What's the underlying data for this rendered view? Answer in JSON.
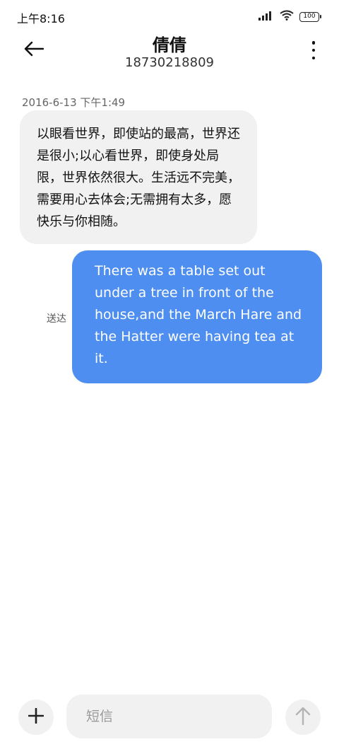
{
  "status_bar": {
    "time": "上午8:16",
    "battery": "100",
    "icons": [
      "signal-icon",
      "wifi-icon",
      "battery-icon"
    ]
  },
  "header": {
    "contact_name": "倩倩",
    "phone_number": "18730218809",
    "icons": [
      "back-arrow-icon",
      "more-vertical-icon"
    ]
  },
  "conversation": {
    "timestamp": "2016-6-13 下午1:49",
    "incoming_message": "以眼看世界，即使站的最高，世界还是很小;以心看世界，即使身处局限，世界依然很大。生活远不完美，需要用心去体会;无需拥有太多，愿快乐与你相随。",
    "outgoing_message": "There was a table set out under a tree in front of the house,and the March Hare and the Hatter were having tea at it.",
    "delivered_status": "送达"
  },
  "composer": {
    "placeholder": "短信",
    "value": "",
    "icons": [
      "plus-icon",
      "send-arrow-icon"
    ]
  },
  "colors": {
    "outgoing_bubble": "#4d8ef0",
    "incoming_bubble": "#f1f1f1",
    "background": "#ffffff"
  }
}
